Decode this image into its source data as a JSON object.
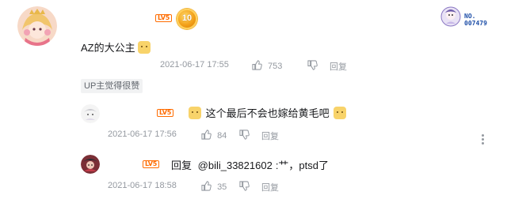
{
  "comment": {
    "username": "",
    "level_badge": "LV5",
    "medal_number": "10",
    "nft_label": "NO.",
    "nft_number": "007479",
    "text": "AZ的大公主",
    "emoji": "dog-face-emoji",
    "time": "2021-06-17 17:55",
    "likes": "753",
    "reply_label": "回复",
    "up_tag": "UP主觉得很赞",
    "colors": {
      "level": "#ff6c00",
      "meta": "#9499a0",
      "text": "#18191c"
    }
  },
  "replies": [
    {
      "level_badge": "LV5",
      "text": "这个最后不会也嫁给黄毛吧",
      "time": "2021-06-17 17:56",
      "likes": "84",
      "reply_label": "回复"
    },
    {
      "level_badge": "LV5",
      "reply_prefix": "回复",
      "mention": "@bili_33821602",
      "text_after": ":艹，ptsd了",
      "time": "2021-06-17 18:58",
      "likes": "35",
      "reply_label": "回复"
    }
  ]
}
